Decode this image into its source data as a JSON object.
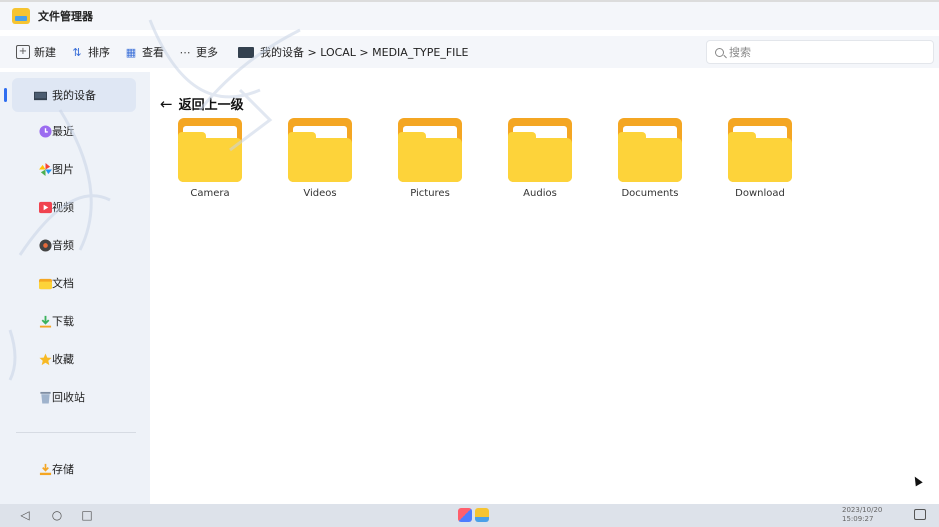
{
  "window": {
    "title": "文件管理器"
  },
  "toolbar": {
    "new_label": "新建",
    "sort_label": "排序",
    "view_label": "查看",
    "more_label": "更多"
  },
  "breadcrumb": {
    "path": "我的设备 > LOCAL > MEDIA_TYPE_FILE"
  },
  "search": {
    "placeholder": "搜索"
  },
  "sidebar": {
    "items": [
      {
        "label": "我的设备",
        "icon": "computer-icon"
      },
      {
        "label": "最近",
        "icon": "clock-icon"
      },
      {
        "label": "图片",
        "icon": "pinwheel-icon"
      },
      {
        "label": "视频",
        "icon": "video-icon"
      },
      {
        "label": "音频",
        "icon": "audio-icon"
      },
      {
        "label": "文档",
        "icon": "folder-icon"
      },
      {
        "label": "下载",
        "icon": "download-icon"
      },
      {
        "label": "收藏",
        "icon": "star-icon"
      },
      {
        "label": "回收站",
        "icon": "trash-icon"
      },
      {
        "label": "存储",
        "icon": "storage-icon"
      }
    ]
  },
  "content": {
    "back_label": "返回上一级",
    "folders": [
      {
        "name": "Camera"
      },
      {
        "name": "Videos"
      },
      {
        "name": "Pictures"
      },
      {
        "name": "Audios"
      },
      {
        "name": "Documents"
      },
      {
        "name": "Download"
      }
    ]
  },
  "taskbar": {
    "date": "2023/10/20",
    "time": "15:09:27"
  },
  "colors": {
    "accent": "#2f6ef0",
    "folder_back": "#f4a623",
    "folder_front": "#fdd33a",
    "sidebar_bg": "#eef2f8"
  }
}
